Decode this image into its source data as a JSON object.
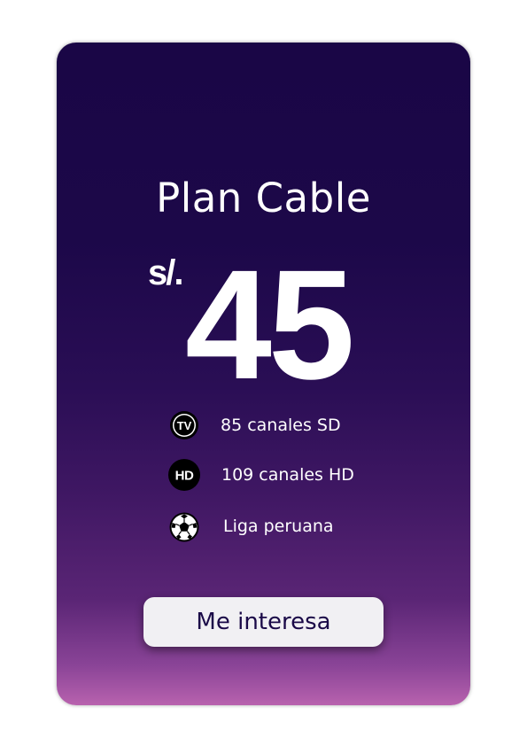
{
  "plan": {
    "title": "Plan Cable",
    "currency": "s/.",
    "price": "45"
  },
  "features": [
    {
      "icon": "tv-icon",
      "label": "85 canales SD"
    },
    {
      "icon": "hd-icon",
      "label": "109 canales HD"
    },
    {
      "icon": "soccer-ball-icon",
      "label": "Liga peruana"
    }
  ],
  "cta": {
    "label": "Me interesa"
  },
  "colors": {
    "card_top": "#1a0646",
    "card_bottom": "#b862ae",
    "button_bg": "#f1f0f3",
    "button_text": "#1b0a48",
    "text": "#ffffff"
  }
}
